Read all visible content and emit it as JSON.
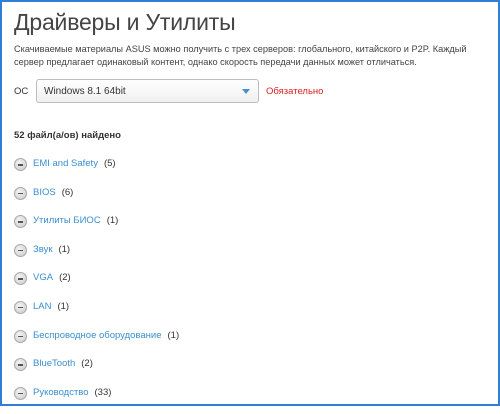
{
  "header": {
    "title": "Драйверы и Утилиты",
    "description": "Скачиваемые материалы ASUS можно получить с трех серверов: глобального, китайского и P2P. Каждый сервер предлагает одинаковый контент, однако скорость передачи данных может отличаться."
  },
  "os": {
    "label": "ОС",
    "selected": "Windows 8.1 64bit",
    "required_label": "Обязательно"
  },
  "results": {
    "count_text": "52 файл(а/ов) найдено"
  },
  "categories": [
    {
      "label": "EMI and Safety",
      "count": "(5)"
    },
    {
      "label": "BIOS",
      "count": "(6)"
    },
    {
      "label": "Утилиты БИОС",
      "count": "(1)"
    },
    {
      "label": "Звук",
      "count": "(1)"
    },
    {
      "label": "VGA",
      "count": "(2)"
    },
    {
      "label": "LAN",
      "count": "(1)"
    },
    {
      "label": "Беспроводное оборудование",
      "count": "(1)"
    },
    {
      "label": "BlueTooth",
      "count": "(2)"
    },
    {
      "label": "Руководство",
      "count": "(33)"
    }
  ],
  "colors": {
    "border": "#2f7fd8",
    "link": "#3a8ed0",
    "required": "#e02020"
  }
}
